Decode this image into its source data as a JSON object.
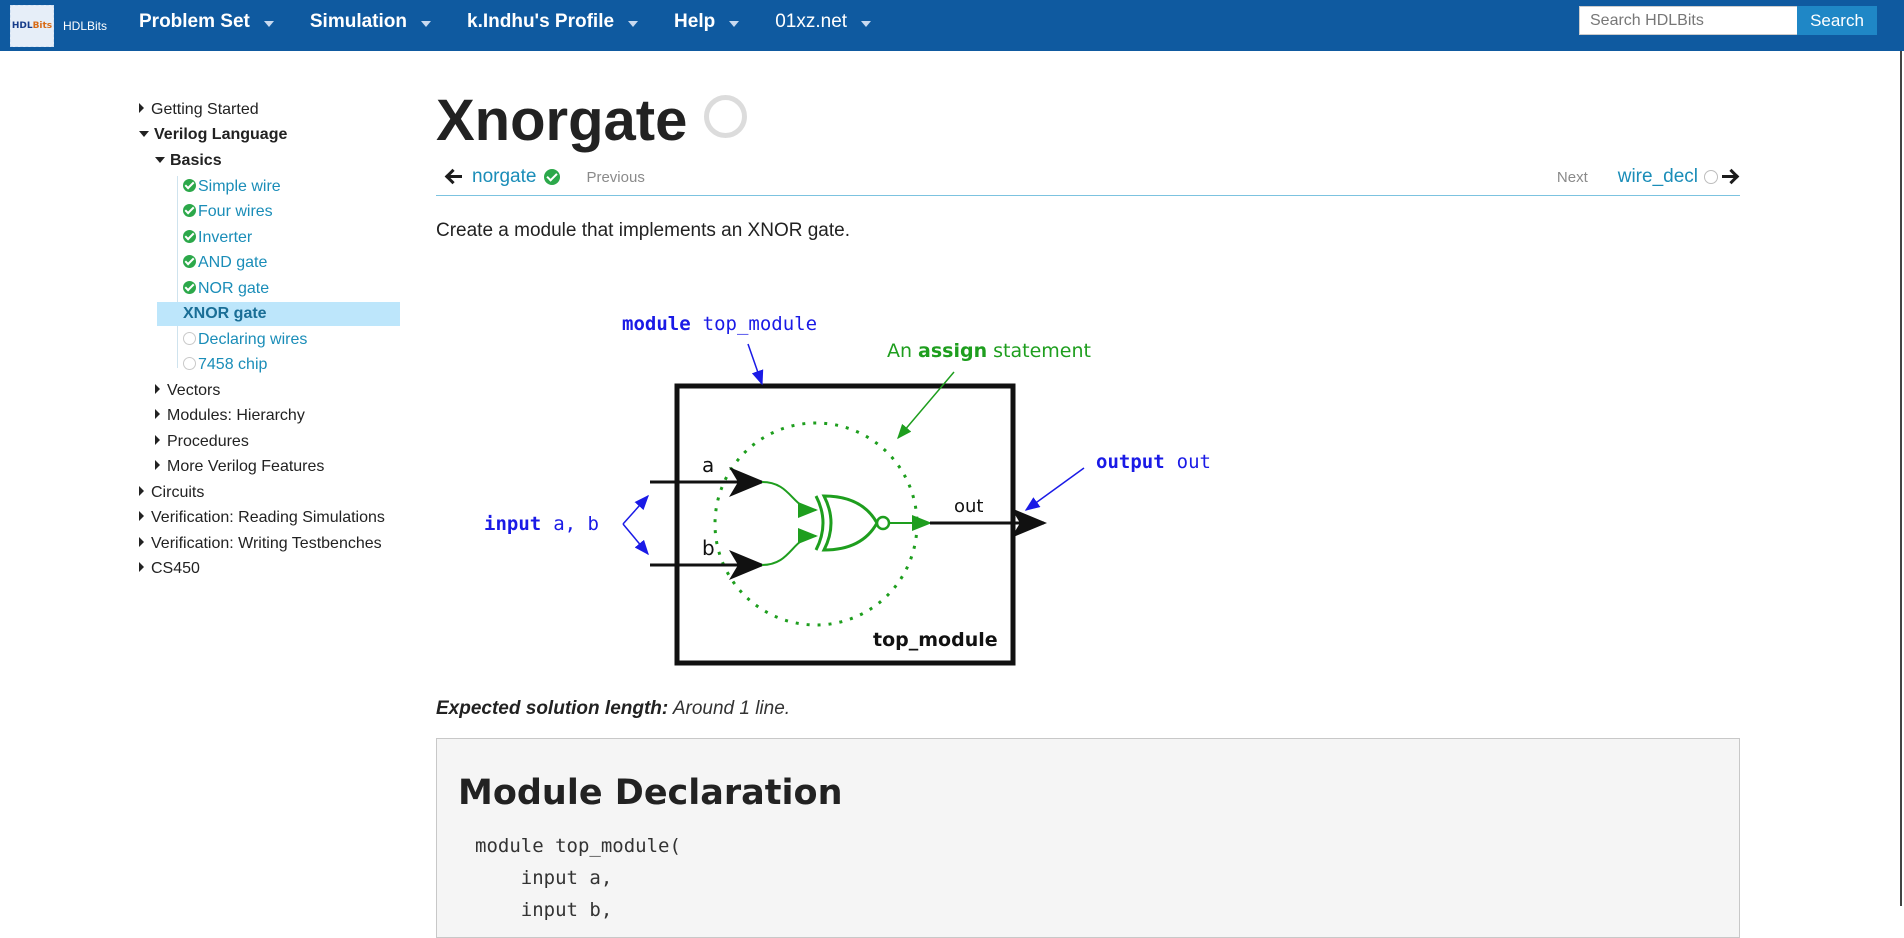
{
  "navbar": {
    "logo_hdl": "HDL",
    "logo_bits": "Bits",
    "logo_text": "HDLBits",
    "menu": [
      {
        "label": "Problem Set"
      },
      {
        "label": "Simulation"
      },
      {
        "label": "k.Indhu's Profile"
      },
      {
        "label": "Help"
      },
      {
        "label": "01xz.net"
      }
    ],
    "search_placeholder": "Search HDLBits",
    "search_button": "Search"
  },
  "sidebar": {
    "items": [
      {
        "label": "Getting Started"
      },
      {
        "label": "Verilog Language"
      },
      {
        "label": "Basics"
      },
      {
        "label": "Simple wire"
      },
      {
        "label": "Four wires"
      },
      {
        "label": "Inverter"
      },
      {
        "label": "AND gate"
      },
      {
        "label": "NOR gate"
      },
      {
        "label": "XNOR gate"
      },
      {
        "label": "Declaring wires"
      },
      {
        "label": "7458 chip"
      },
      {
        "label": "Vectors"
      },
      {
        "label": "Modules: Hierarchy"
      },
      {
        "label": "Procedures"
      },
      {
        "label": "More Verilog Features"
      },
      {
        "label": "Circuits"
      },
      {
        "label": "Verification: Reading Simulations"
      },
      {
        "label": "Verification: Writing Testbenches"
      },
      {
        "label": "CS450"
      }
    ]
  },
  "main": {
    "title": "Xnorgate",
    "prev_link": "norgate",
    "prev_label": "Previous",
    "next_label": "Next",
    "next_link": "wire_decl",
    "description": "Create a module that implements an XNOR gate.",
    "diagram": {
      "module_kw": "module",
      "module_name": "top_module",
      "assign_pre": "An",
      "assign_kw": "assign",
      "assign_post": "statement",
      "input_kw": "input",
      "input_names": "a, b",
      "output_kw": "output",
      "output_name": "out",
      "wire_a": "a",
      "wire_b": "b",
      "wire_out": "out",
      "box_label": "top_module",
      "color_blue": "#1a1ae6",
      "color_green": "#1e9e1e"
    },
    "expected_label": "Expected solution length:",
    "expected_value": "Around 1 line.",
    "module_declaration": {
      "heading": "Module Declaration",
      "lines": [
        "module top_module(",
        "    input a,",
        "    input b,"
      ]
    }
  }
}
